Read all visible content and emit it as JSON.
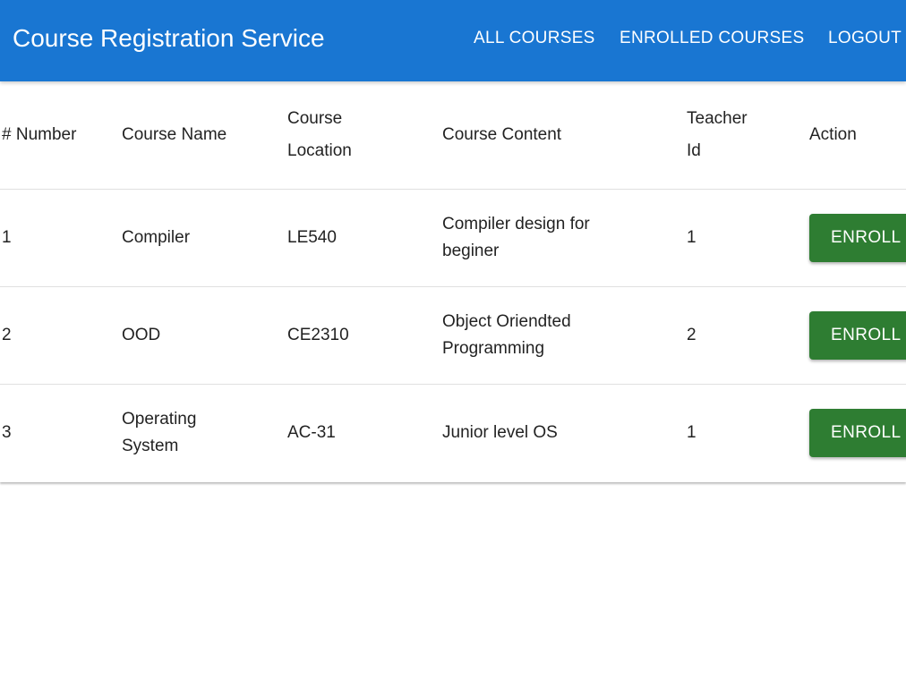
{
  "app": {
    "title": "Course Registration Service",
    "nav": [
      "ALL COURSES",
      "ENROLLED COURSES",
      "LOGOUT"
    ]
  },
  "colors": {
    "appbar": "#1976d2",
    "enroll_button": "#2e7d32"
  },
  "table": {
    "headers": {
      "number": "# Number",
      "name": "Course Name",
      "location": "Course Location",
      "content": "Course Content",
      "teacher": "Teacher Id",
      "action": "Action"
    },
    "rows": [
      {
        "number": "1",
        "name": "Compiler",
        "location": "LE540",
        "content": "Compiler design for beginer",
        "teacher": "1",
        "action": "ENROLL"
      },
      {
        "number": "2",
        "name": "OOD",
        "location": "CE2310",
        "content": "Object Oriendted Programming",
        "teacher": "2",
        "action": "ENROLL"
      },
      {
        "number": "3",
        "name": "Operating System",
        "location": "AC-31",
        "content": "Junior level OS",
        "teacher": "1",
        "action": "ENROLL"
      }
    ]
  }
}
